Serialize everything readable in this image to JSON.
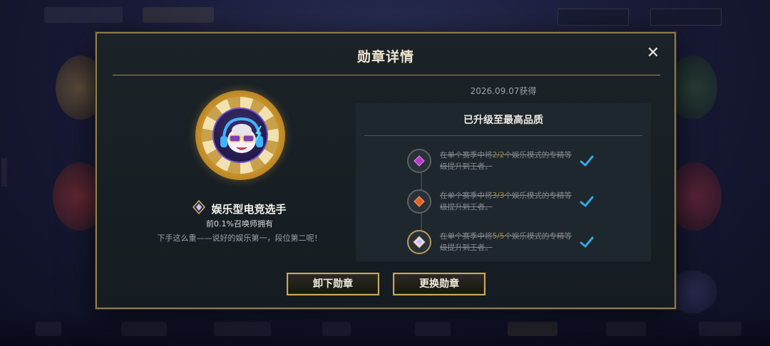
{
  "modal": {
    "title": "勋章详情",
    "close_icon": "close-icon"
  },
  "medal": {
    "name": "娱乐型电竞选手",
    "rarity": "前0.1%召唤师拥有",
    "description": "下手这么重——说好的娱乐第一，段位第二呢！",
    "badge_icon": "diamond-rank-icon",
    "emblem_icon": "poro-sunglasses-emblem-icon"
  },
  "obtain_date": "2026.09.07获得",
  "quality": {
    "title": "已升级至最高品质",
    "tiers": [
      {
        "prefix": "在单个赛季中将",
        "count": "2/2",
        "suffix": "个娱乐模式的专精等级提升到王者。",
        "icon": "purple-gem-tier-icon",
        "color": "#b43cc8",
        "completed": true
      },
      {
        "prefix": "在单个赛季中将",
        "count": "3/3",
        "suffix": "个娱乐模式的专精等级提升到王者。",
        "icon": "orange-gem-tier-icon",
        "color": "#e2622b",
        "completed": true
      },
      {
        "prefix": "在单个赛季中将",
        "count": "5/5",
        "suffix": "个娱乐模式的专精等级提升到王者。",
        "icon": "prismatic-gem-tier-icon",
        "color": "#9fd0f0",
        "completed": true
      }
    ],
    "check_color": "#34a7e0"
  },
  "buttons": {
    "remove": "卸下勋章",
    "change": "更换勋章"
  },
  "colors": {
    "accent_gold": "#c9a85a",
    "panel_bg": "#1e272d",
    "modal_bg": "#1b2328"
  }
}
